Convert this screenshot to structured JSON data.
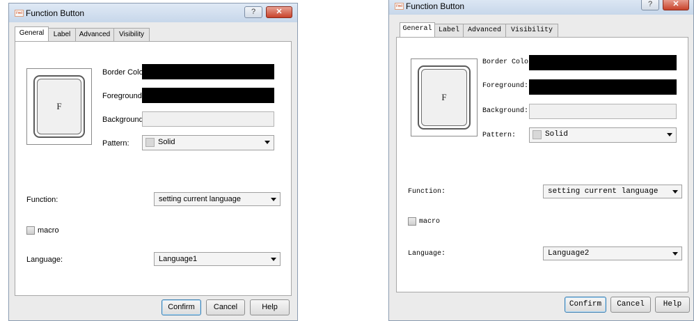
{
  "left_dialog": {
    "title": "Function Button",
    "app_icon": "app-icon",
    "titlebar_help": "?",
    "titlebar_close": "✕",
    "tabs": [
      "General",
      "Label",
      "Advanced",
      "Visibility"
    ],
    "active_tab": "General",
    "preview_letter": "F",
    "border_color_label": "Border Color:",
    "foreground_label": "Foreground:",
    "background_label": "Background:",
    "pattern_label": "Pattern:",
    "pattern_value": "Solid",
    "function_label": "Function:",
    "function_value": "setting current language",
    "macro_label": "macro",
    "language_label": "Language:",
    "language_value": "Language1",
    "confirm": "Confirm",
    "cancel": "Cancel",
    "help": "Help"
  },
  "right_dialog": {
    "title": "Function Button",
    "app_icon": "app-icon",
    "titlebar_help": "?",
    "titlebar_close": "✕",
    "tabs": [
      "General",
      "Label",
      "Advanced",
      "Visibility"
    ],
    "active_tab": "General",
    "preview_letter": "F",
    "border_color_label": "Border Color:",
    "foreground_label": "Foreground:",
    "background_label": "Background:",
    "pattern_label": "Pattern:",
    "pattern_value": "Solid",
    "function_label": "Function:",
    "function_value": "setting current language",
    "macro_label": "macro",
    "language_label": "Language:",
    "language_value": "Language2",
    "confirm": "Confirm",
    "cancel": "Cancel",
    "help": "Help"
  },
  "colors": {
    "border_color": "#000000",
    "foreground": "#000000",
    "background": "#f0f0f0",
    "close_button": "#c8422a"
  }
}
